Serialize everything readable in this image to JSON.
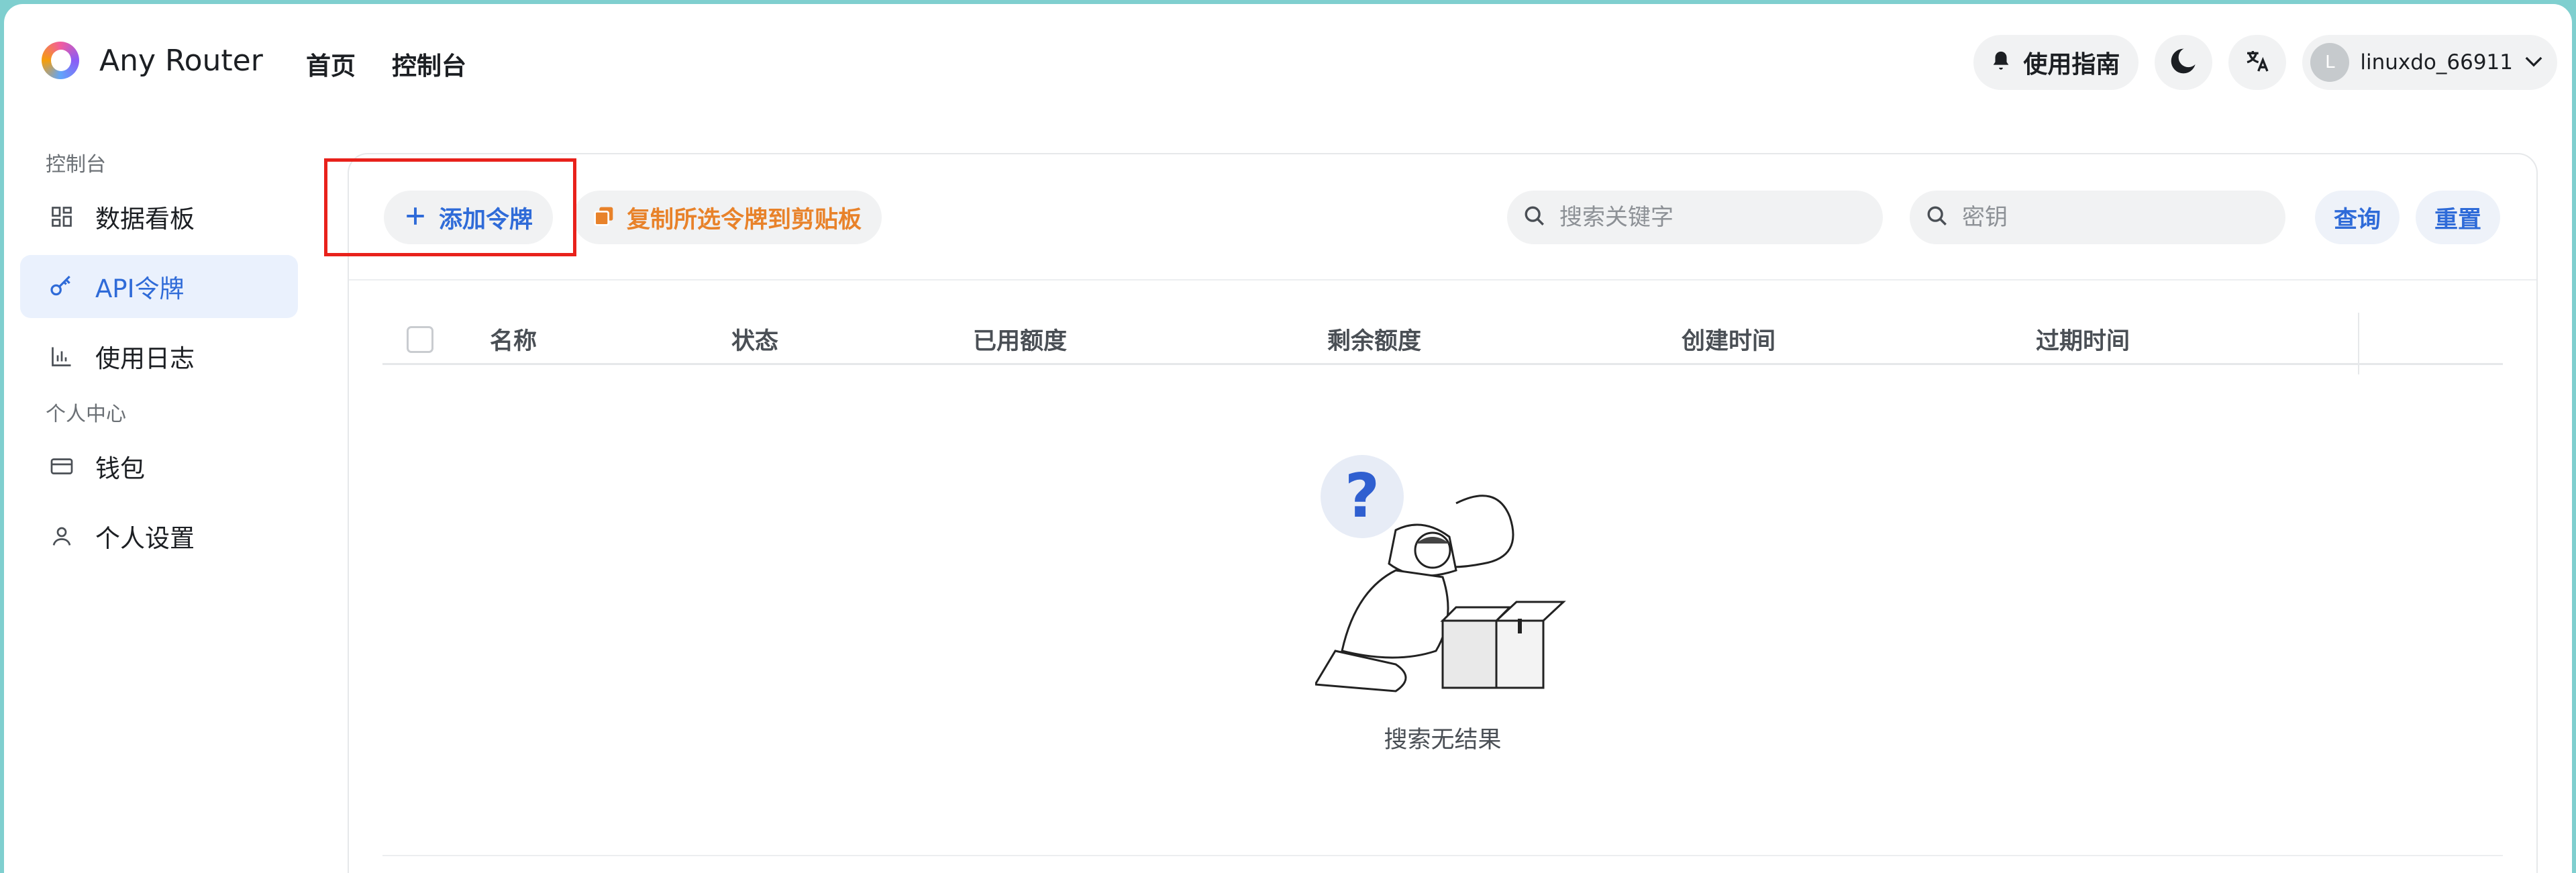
{
  "app": {
    "title": "Any Router"
  },
  "nav": {
    "items": [
      "首页",
      "控制台"
    ]
  },
  "header": {
    "guide_label": "使用指南",
    "user": {
      "initial": "L",
      "name": "linuxdo_66911"
    }
  },
  "sidebar": {
    "section1": "控制台",
    "section2": "个人中心",
    "items": [
      {
        "label": "数据看板",
        "icon": "dashboard-icon"
      },
      {
        "label": "API令牌",
        "icon": "key-icon",
        "active": true
      },
      {
        "label": "使用日志",
        "icon": "chart-icon"
      },
      {
        "label": "钱包",
        "icon": "wallet-icon"
      },
      {
        "label": "个人设置",
        "icon": "user-icon"
      }
    ]
  },
  "toolbar": {
    "add_label": "添加令牌",
    "copy_label": "复制所选令牌到剪贴板",
    "search_placeholder": "搜索关键字",
    "key_placeholder": "密钥",
    "query_label": "查询",
    "reset_label": "重置"
  },
  "table": {
    "columns": [
      "名称",
      "状态",
      "已用额度",
      "剩余额度",
      "创建时间",
      "过期时间"
    ],
    "rows": [],
    "empty_text": "搜索无结果"
  },
  "colors": {
    "accent": "#2f6bd8",
    "copy_orange": "#e8822a",
    "highlight": "#e8211b"
  }
}
